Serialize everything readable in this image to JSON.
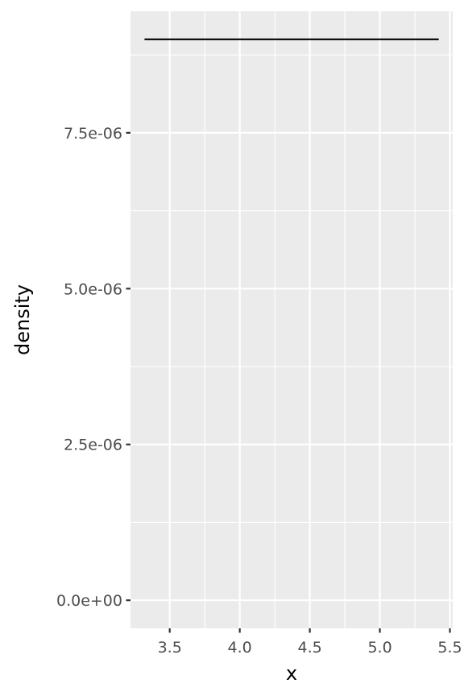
{
  "chart_data": {
    "type": "line",
    "title": "",
    "xlabel": "x",
    "ylabel": "density",
    "xlim": [
      3.22,
      5.52
    ],
    "ylim": [
      -4.5e-07,
      9.45e-06
    ],
    "x_ticks": [
      {
        "value": 3.5,
        "label": "3.5"
      },
      {
        "value": 4.0,
        "label": "4.0"
      },
      {
        "value": 4.5,
        "label": "4.5"
      },
      {
        "value": 5.0,
        "label": "5.0"
      },
      {
        "value": 5.5,
        "label": "5.5"
      }
    ],
    "x_minor_breaks": [
      3.75,
      4.25,
      4.75,
      5.25
    ],
    "y_ticks": [
      {
        "value": 0.0,
        "label": "0.0e+00"
      },
      {
        "value": 2.5e-06,
        "label": "2.5e-06"
      },
      {
        "value": 5e-06,
        "label": "5.0e-06"
      },
      {
        "value": 7.5e-06,
        "label": "7.5e-06"
      }
    ],
    "y_minor_breaks": [
      1.25e-06,
      3.75e-06,
      6.25e-06,
      8.75e-06
    ],
    "grid": true,
    "legend": "none",
    "series": [
      {
        "x": [
          3.32,
          5.42
        ],
        "y": [
          9e-06,
          9e-06
        ]
      }
    ],
    "colors": {
      "panel_background": "#EBEBEB",
      "grid_line": "#FFFFFF",
      "line": "#000000",
      "axis_text": "#4D4D4D",
      "axis_title": "#000000",
      "tick_mark": "#333333"
    }
  }
}
